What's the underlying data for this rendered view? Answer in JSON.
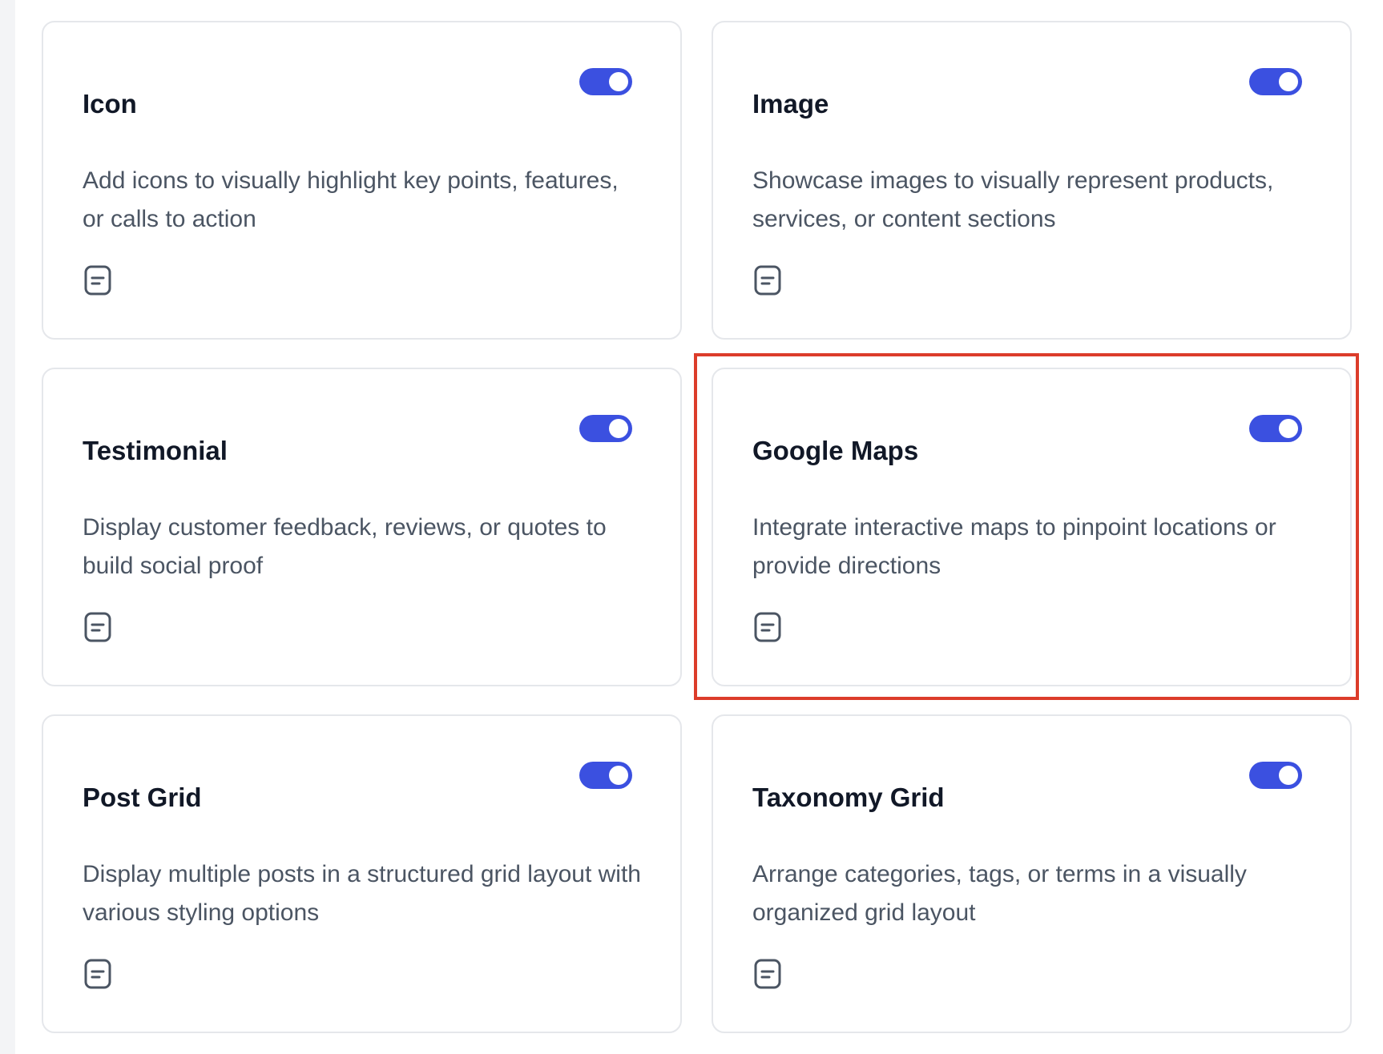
{
  "cards": [
    {
      "title": "Icon",
      "description": "Add icons to visually highlight key points, features, or calls to action",
      "enabled": true,
      "toggle_icon": "toggle-on-icon",
      "doc_icon": "document-icon"
    },
    {
      "title": "Image",
      "description": "Showcase images to visually represent products, services, or content sections",
      "enabled": true,
      "toggle_icon": "toggle-on-icon",
      "doc_icon": "document-icon"
    },
    {
      "title": "Testimonial",
      "description": "Display customer feedback, reviews, or quotes to build social proof",
      "enabled": true,
      "toggle_icon": "toggle-on-icon",
      "doc_icon": "document-icon"
    },
    {
      "title": "Google Maps",
      "description": "Integrate interactive maps to pinpoint locations or provide directions",
      "enabled": true,
      "toggle_icon": "toggle-on-icon",
      "doc_icon": "document-icon",
      "highlighted": true
    },
    {
      "title": "Post Grid",
      "description": "Display multiple posts in a structured grid layout with various styling options",
      "enabled": true,
      "toggle_icon": "toggle-on-icon",
      "doc_icon": "document-icon"
    },
    {
      "title": "Taxonomy Grid",
      "description": "Arrange categories, tags, or terms in a visually organized grid layout",
      "enabled": true,
      "toggle_icon": "toggle-on-icon",
      "doc_icon": "document-icon"
    }
  ],
  "colors": {
    "toggle_on": "#3b50e0",
    "highlight_border": "#dc3c2a",
    "card_border": "#e5e7eb",
    "title_text": "#111827",
    "description_text": "#4b5563"
  }
}
